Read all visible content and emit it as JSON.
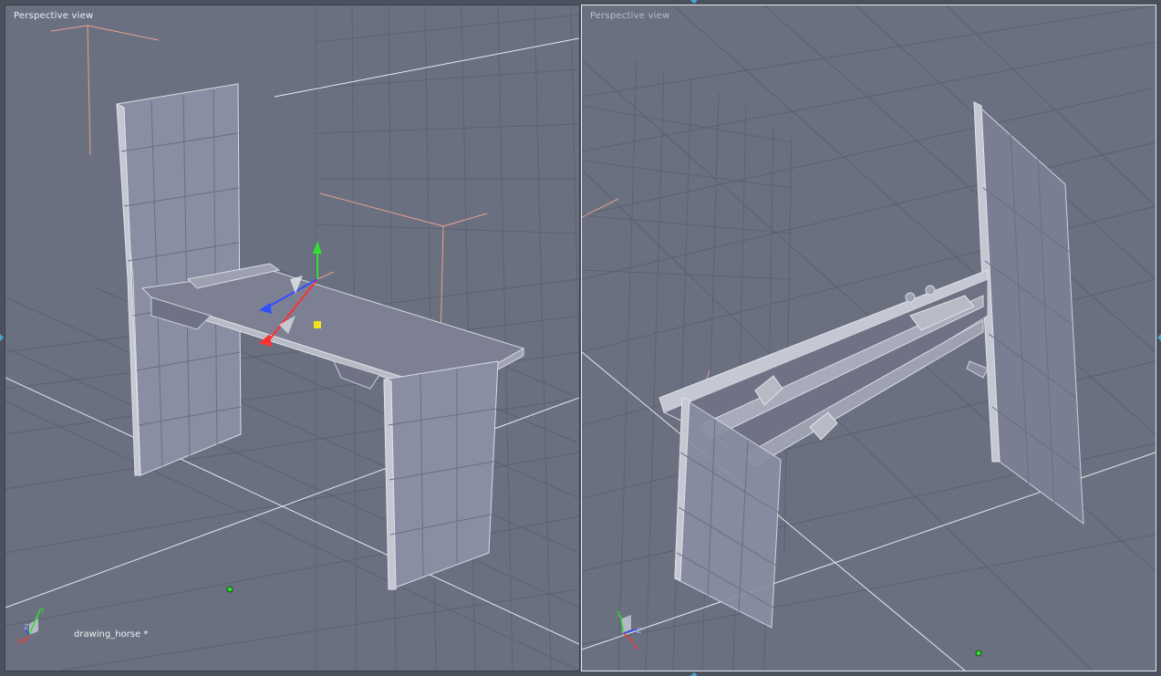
{
  "viewports": {
    "left": {
      "label": "Perspective view",
      "scene_name": "drawing_horse *"
    },
    "right": {
      "label": "Perspective view"
    }
  },
  "gizmo": {
    "axes": {
      "x": "X",
      "y": "Y",
      "z": "Z"
    },
    "colors": {
      "x": "#ff3030",
      "y": "#30e030",
      "z": "#3050ff"
    }
  },
  "colors": {
    "viewport_bg": "#6b7080",
    "grid": "#5a6070",
    "grid_bright": "#e8eaf0",
    "helper_lines": "#e8a090",
    "active_border": "#e6e8ee",
    "object_fill": "#8a8ea0"
  },
  "icons": {
    "move_manipulator": "move-manipulator-icon",
    "axis_gizmo": "axis-gizmo-icon",
    "pivot": "pivot-point-icon",
    "pane_edge": "pane-edge-marker-icon"
  }
}
